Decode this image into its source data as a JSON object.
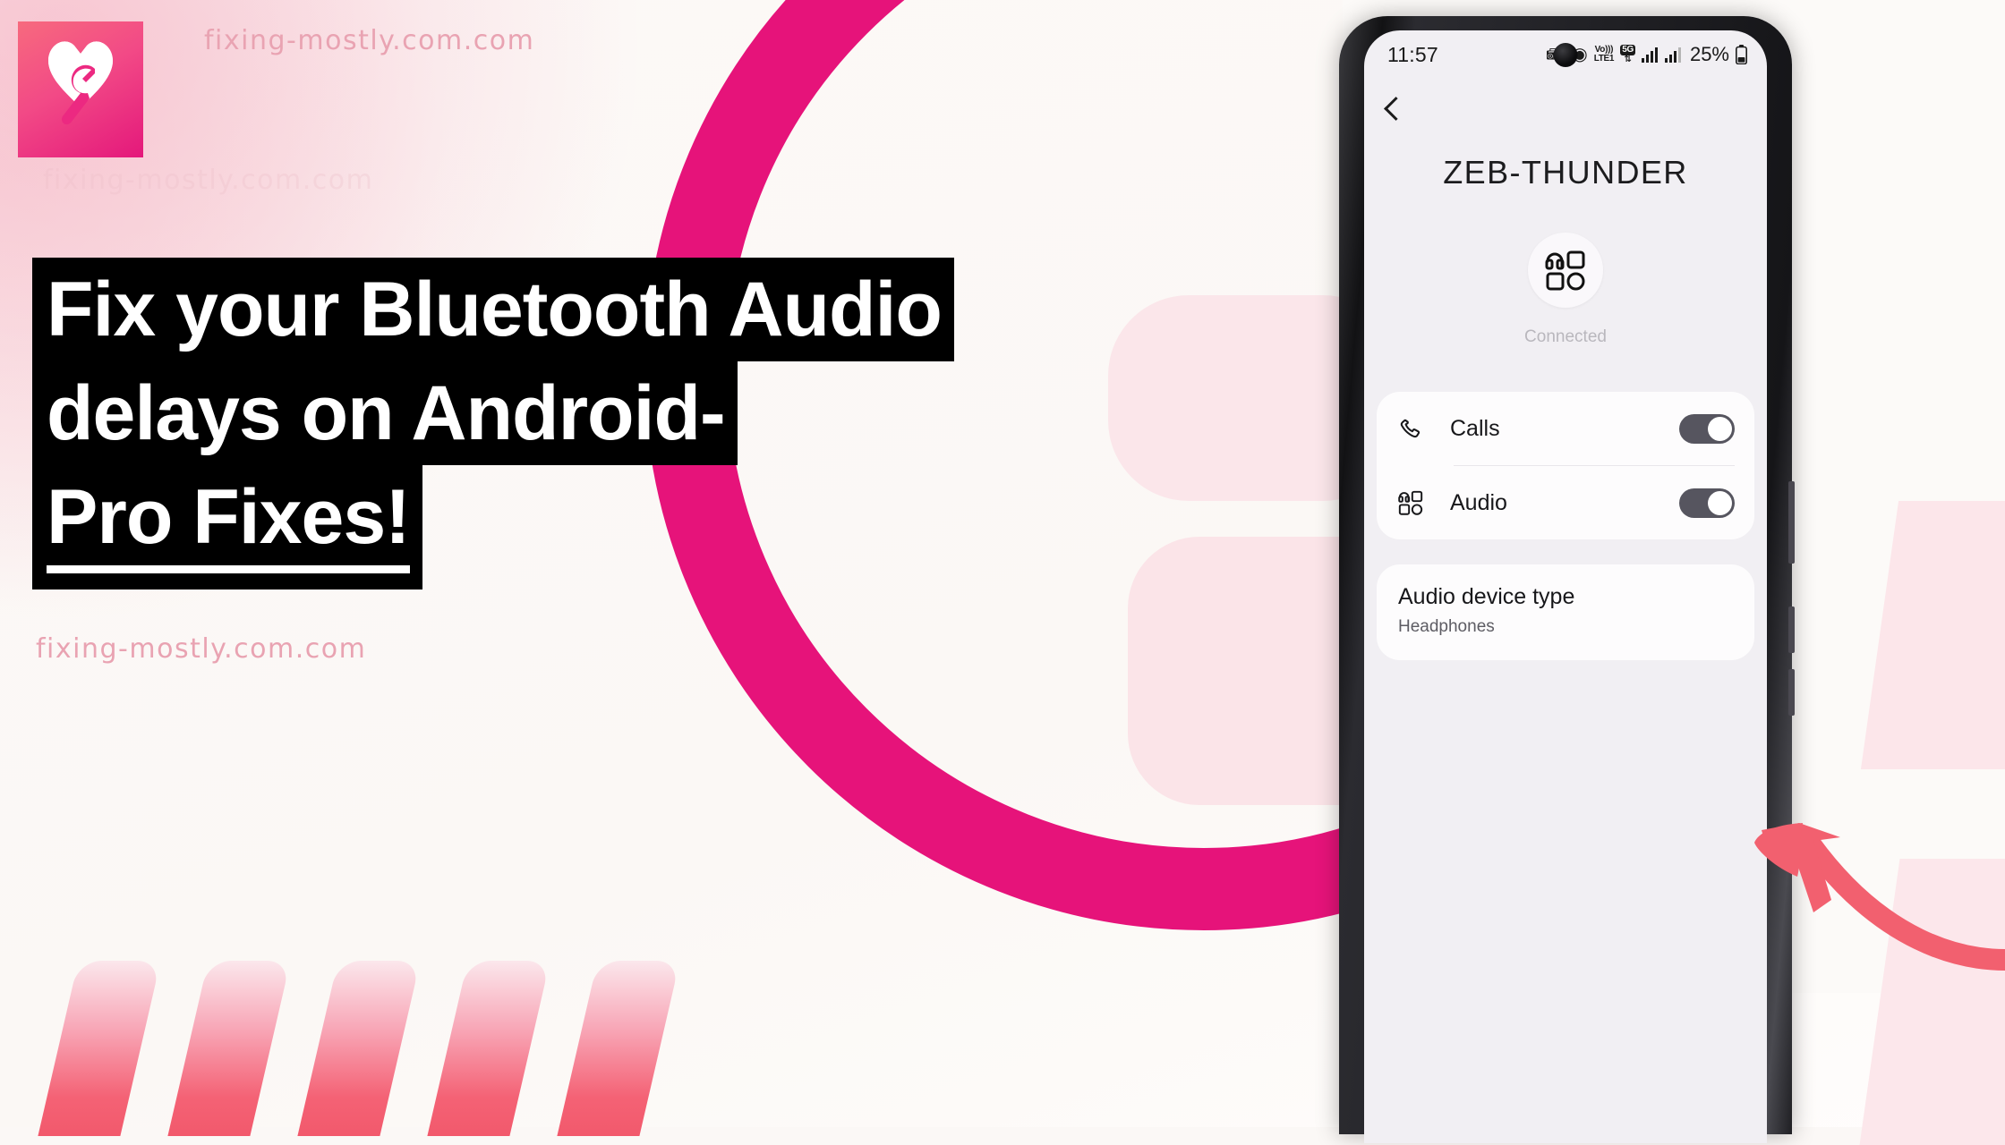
{
  "brand": {
    "watermark_text": "fixing-mostly.com.com",
    "logo_name": "heart-wrench-logo",
    "accent_pink": "#E6137A",
    "accent_coral": "#F2596C"
  },
  "headline": {
    "line1": "Fix your Bluetooth Audio",
    "line2": "delays on Android-",
    "line3": "Pro Fixes!"
  },
  "phone": {
    "status_bar": {
      "time": "11:57",
      "bluetooth_icon": "bluetooth-icon",
      "hotspot_icon": "hotspot-icon",
      "volte_label_top": "Vo)))",
      "volte_label_bottom": "LTE1",
      "network_badge": "5G",
      "network_arrows": "data-transfer-icon",
      "signal_1_icon": "signal-bars-icon",
      "signal_2_icon": "signal-bars-icon",
      "battery_percent": "25%",
      "battery_icon": "battery-icon"
    },
    "back_button": "back-chevron",
    "device_name": "ZEB-THUNDER",
    "device_icon": "audio-device-grid-icon",
    "connection_status": "Connected",
    "rows": [
      {
        "label": "Calls",
        "icon": "phone-call-icon",
        "toggle_on": true
      },
      {
        "label": "Audio",
        "icon": "audio-device-grid-icon",
        "toggle_on": true
      }
    ],
    "audio_device_type": {
      "title": "Audio device type",
      "value": "Headphones"
    }
  },
  "annotation": {
    "arrow_name": "pointer-arrow",
    "arrow_color": "#F2606F",
    "points_to": "Audio device type"
  }
}
